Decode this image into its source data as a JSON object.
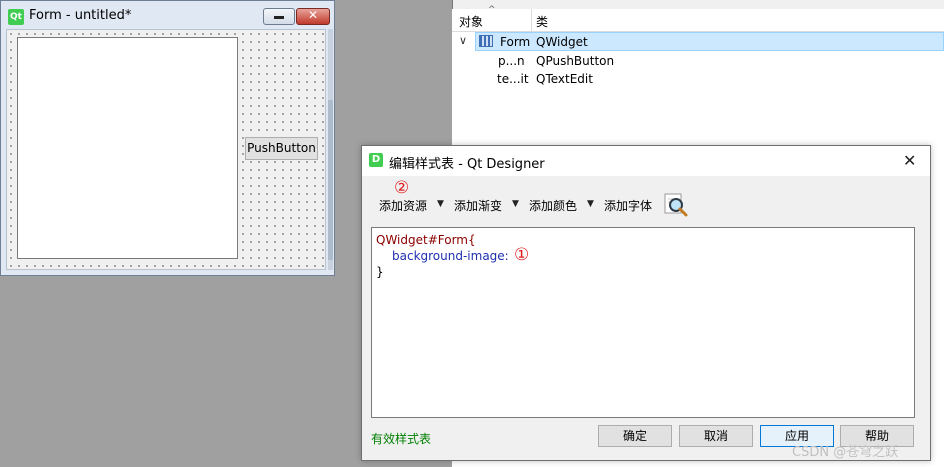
{
  "form_window": {
    "title": "Form - untitled*",
    "logo": "Qt",
    "close_glyph": "✕",
    "push_button_label": "PushButton"
  },
  "inspector": {
    "header_object": "对象",
    "header_class": "类",
    "rows": [
      {
        "object": "Form",
        "class": "QWidget"
      },
      {
        "object": "p...n",
        "class": "QPushButton"
      },
      {
        "object": "te...it",
        "class": "QTextEdit"
      }
    ]
  },
  "dialog": {
    "logo": "D",
    "title": "编辑样式表 - Qt Designer",
    "close_glyph": "✕",
    "toolbar": {
      "add_resource": "添加资源",
      "add_gradient": "添加渐变",
      "add_color": "添加颜色",
      "add_font": "添加字体"
    },
    "annotations": {
      "one": "①",
      "two": "②"
    },
    "code": {
      "line1": "QWidget#Form{",
      "line2": "background-image:",
      "line3": "}"
    },
    "status": "有效样式表",
    "buttons": {
      "ok": "确定",
      "cancel": "取消",
      "apply": "应用",
      "help": "帮助"
    }
  },
  "watermark": "CSDN @苍穹之跃",
  "colors": {
    "selection": "#cce8ff",
    "valid_green": "#008000",
    "annotation_red": "#e02020",
    "selector_color": "#8b0000",
    "property_color": "#1f2fb0"
  }
}
